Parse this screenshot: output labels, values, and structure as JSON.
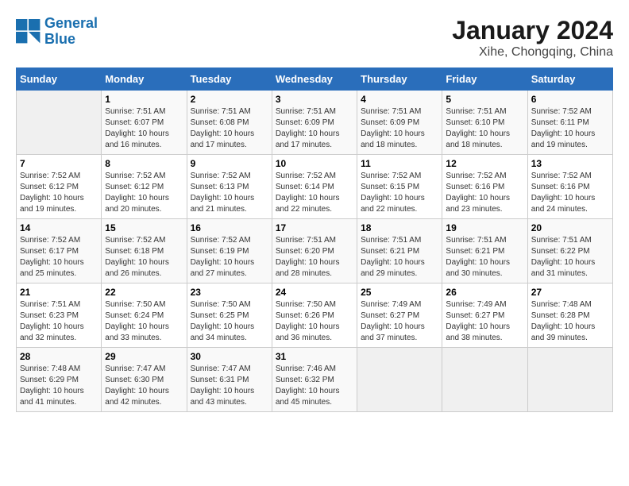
{
  "header": {
    "logo_line1": "General",
    "logo_line2": "Blue",
    "title": "January 2024",
    "subtitle": "Xihe, Chongqing, China"
  },
  "weekdays": [
    "Sunday",
    "Monday",
    "Tuesday",
    "Wednesday",
    "Thursday",
    "Friday",
    "Saturday"
  ],
  "weeks": [
    [
      {
        "day": "",
        "info": ""
      },
      {
        "day": "1",
        "info": "Sunrise: 7:51 AM\nSunset: 6:07 PM\nDaylight: 10 hours\nand 16 minutes."
      },
      {
        "day": "2",
        "info": "Sunrise: 7:51 AM\nSunset: 6:08 PM\nDaylight: 10 hours\nand 17 minutes."
      },
      {
        "day": "3",
        "info": "Sunrise: 7:51 AM\nSunset: 6:09 PM\nDaylight: 10 hours\nand 17 minutes."
      },
      {
        "day": "4",
        "info": "Sunrise: 7:51 AM\nSunset: 6:09 PM\nDaylight: 10 hours\nand 18 minutes."
      },
      {
        "day": "5",
        "info": "Sunrise: 7:51 AM\nSunset: 6:10 PM\nDaylight: 10 hours\nand 18 minutes."
      },
      {
        "day": "6",
        "info": "Sunrise: 7:52 AM\nSunset: 6:11 PM\nDaylight: 10 hours\nand 19 minutes."
      }
    ],
    [
      {
        "day": "7",
        "info": "Sunrise: 7:52 AM\nSunset: 6:12 PM\nDaylight: 10 hours\nand 19 minutes."
      },
      {
        "day": "8",
        "info": "Sunrise: 7:52 AM\nSunset: 6:12 PM\nDaylight: 10 hours\nand 20 minutes."
      },
      {
        "day": "9",
        "info": "Sunrise: 7:52 AM\nSunset: 6:13 PM\nDaylight: 10 hours\nand 21 minutes."
      },
      {
        "day": "10",
        "info": "Sunrise: 7:52 AM\nSunset: 6:14 PM\nDaylight: 10 hours\nand 22 minutes."
      },
      {
        "day": "11",
        "info": "Sunrise: 7:52 AM\nSunset: 6:15 PM\nDaylight: 10 hours\nand 22 minutes."
      },
      {
        "day": "12",
        "info": "Sunrise: 7:52 AM\nSunset: 6:16 PM\nDaylight: 10 hours\nand 23 minutes."
      },
      {
        "day": "13",
        "info": "Sunrise: 7:52 AM\nSunset: 6:16 PM\nDaylight: 10 hours\nand 24 minutes."
      }
    ],
    [
      {
        "day": "14",
        "info": "Sunrise: 7:52 AM\nSunset: 6:17 PM\nDaylight: 10 hours\nand 25 minutes."
      },
      {
        "day": "15",
        "info": "Sunrise: 7:52 AM\nSunset: 6:18 PM\nDaylight: 10 hours\nand 26 minutes."
      },
      {
        "day": "16",
        "info": "Sunrise: 7:52 AM\nSunset: 6:19 PM\nDaylight: 10 hours\nand 27 minutes."
      },
      {
        "day": "17",
        "info": "Sunrise: 7:51 AM\nSunset: 6:20 PM\nDaylight: 10 hours\nand 28 minutes."
      },
      {
        "day": "18",
        "info": "Sunrise: 7:51 AM\nSunset: 6:21 PM\nDaylight: 10 hours\nand 29 minutes."
      },
      {
        "day": "19",
        "info": "Sunrise: 7:51 AM\nSunset: 6:21 PM\nDaylight: 10 hours\nand 30 minutes."
      },
      {
        "day": "20",
        "info": "Sunrise: 7:51 AM\nSunset: 6:22 PM\nDaylight: 10 hours\nand 31 minutes."
      }
    ],
    [
      {
        "day": "21",
        "info": "Sunrise: 7:51 AM\nSunset: 6:23 PM\nDaylight: 10 hours\nand 32 minutes."
      },
      {
        "day": "22",
        "info": "Sunrise: 7:50 AM\nSunset: 6:24 PM\nDaylight: 10 hours\nand 33 minutes."
      },
      {
        "day": "23",
        "info": "Sunrise: 7:50 AM\nSunset: 6:25 PM\nDaylight: 10 hours\nand 34 minutes."
      },
      {
        "day": "24",
        "info": "Sunrise: 7:50 AM\nSunset: 6:26 PM\nDaylight: 10 hours\nand 36 minutes."
      },
      {
        "day": "25",
        "info": "Sunrise: 7:49 AM\nSunset: 6:27 PM\nDaylight: 10 hours\nand 37 minutes."
      },
      {
        "day": "26",
        "info": "Sunrise: 7:49 AM\nSunset: 6:27 PM\nDaylight: 10 hours\nand 38 minutes."
      },
      {
        "day": "27",
        "info": "Sunrise: 7:48 AM\nSunset: 6:28 PM\nDaylight: 10 hours\nand 39 minutes."
      }
    ],
    [
      {
        "day": "28",
        "info": "Sunrise: 7:48 AM\nSunset: 6:29 PM\nDaylight: 10 hours\nand 41 minutes."
      },
      {
        "day": "29",
        "info": "Sunrise: 7:47 AM\nSunset: 6:30 PM\nDaylight: 10 hours\nand 42 minutes."
      },
      {
        "day": "30",
        "info": "Sunrise: 7:47 AM\nSunset: 6:31 PM\nDaylight: 10 hours\nand 43 minutes."
      },
      {
        "day": "31",
        "info": "Sunrise: 7:46 AM\nSunset: 6:32 PM\nDaylight: 10 hours\nand 45 minutes."
      },
      {
        "day": "",
        "info": ""
      },
      {
        "day": "",
        "info": ""
      },
      {
        "day": "",
        "info": ""
      }
    ]
  ]
}
